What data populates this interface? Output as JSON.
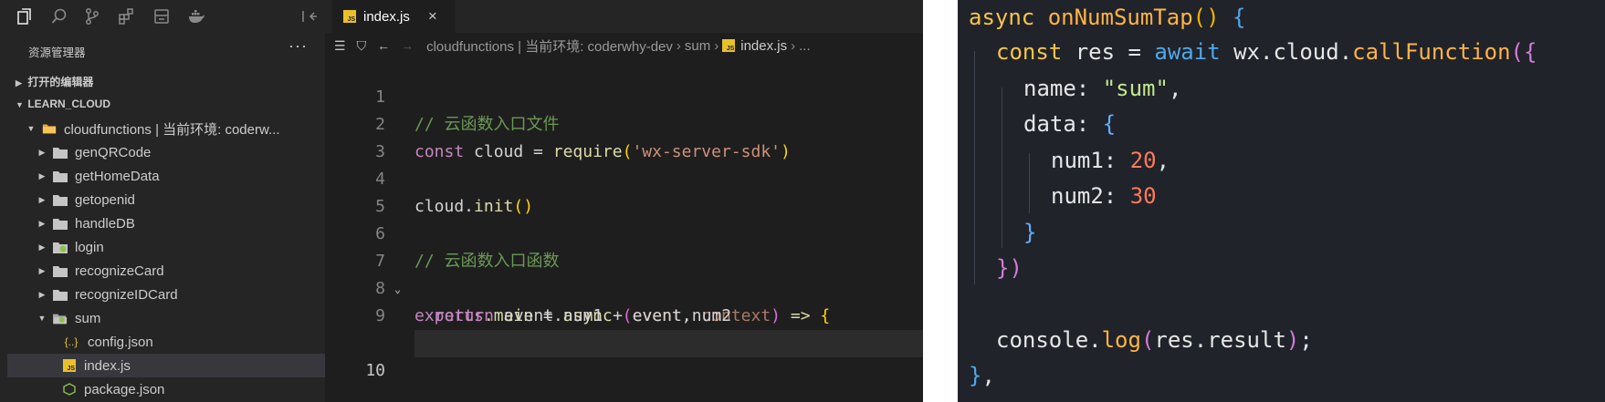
{
  "explorer": {
    "title": "资源管理器",
    "more": "···",
    "open_editors": "打开的编辑器",
    "workspace": "LEARN_CLOUD",
    "root_folder": "cloudfunctions | 当前环境: coderw...",
    "folders": [
      "genQRCode",
      "getHomeData",
      "getopenid",
      "handleDB",
      "login",
      "recognizeCard",
      "recognizeIDCard",
      "sum"
    ],
    "sum_children": [
      "config.json",
      "index.js",
      "package.json"
    ]
  },
  "editor": {
    "tab_label": "index.js",
    "tab_close": "×",
    "breadcrumb": [
      "cloudfunctions | 当前环境: coderwhy-dev",
      "sum",
      "index.js",
      "..."
    ],
    "line_numbers": [
      "1",
      "2",
      "3",
      "4",
      "5",
      "6",
      "7",
      "8",
      "9",
      "10"
    ],
    "code": {
      "l1": "// 云函数入口文件",
      "l2_kw": "const",
      "l2_var": " cloud = ",
      "l2_fn": "require",
      "l2_str": "'wx-server-sdk'",
      "l4_var": "cloud.",
      "l4_fn": "init",
      "l6": "// 云函数入口函数",
      "l7_kw": "exports",
      "l7_main": ".main",
      "l7_eq": " = ",
      "l7_async": "async",
      "l7_p1": "event",
      "l7_comma": ", ",
      "l7_p2": "context",
      "l7_arrow": " => ",
      "l8_kw": "return",
      "l8_rest": " event.num1 + event.num2"
    }
  },
  "snippet": {
    "l1_kw": "async",
    "l1_fn": "onNumSumTap",
    "l2_const": "const",
    "l2_res": " res = ",
    "l2_await": "await",
    "l2_obj": " wx.cloud.",
    "l2_fn": "callFunction",
    "l3_key": "name: ",
    "l3_val": "\"sum\"",
    "l4_key": "data: ",
    "l5_key": "num1: ",
    "l5_val": "20",
    "l6_key": "num2: ",
    "l6_val": "30",
    "l10_obj": "console.",
    "l10_fn": "log",
    "l10_arg": "res.result"
  }
}
